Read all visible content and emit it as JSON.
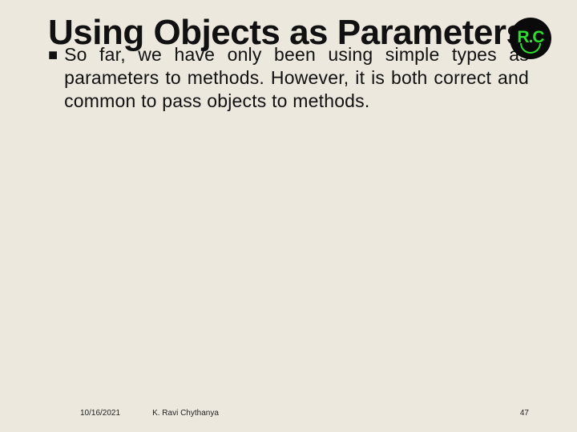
{
  "slide": {
    "title": "Using Objects as Parameters",
    "bullet_glyph": "■",
    "body": "So far, we have only been using simple types as parameters to methods. However, it is both correct and common to pass objects to methods."
  },
  "logo": {
    "text": "R.C"
  },
  "footer": {
    "date": "10/16/2021",
    "author": "K. Ravi Chythanya",
    "page": "47"
  }
}
